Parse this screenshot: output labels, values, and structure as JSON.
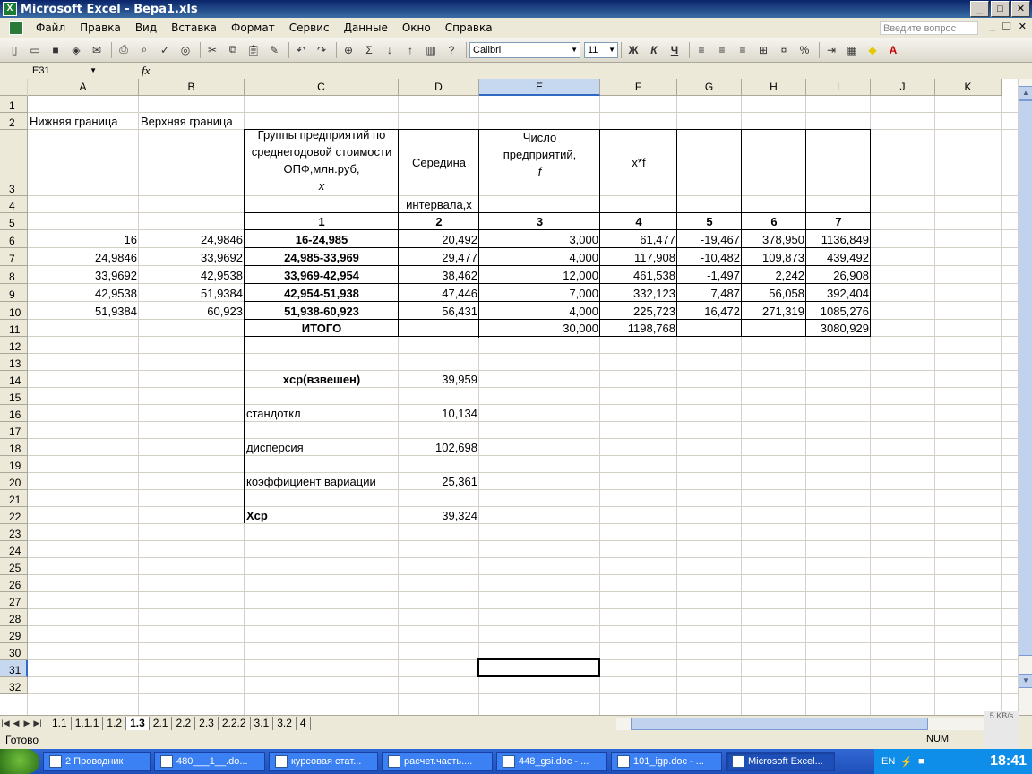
{
  "window": {
    "title": "Microsoft Excel - Вера1.xls",
    "app_icon": "X"
  },
  "menu": {
    "items": [
      "Файл",
      "Правка",
      "Вид",
      "Вставка",
      "Формат",
      "Сервис",
      "Данные",
      "Окно",
      "Справка"
    ],
    "help_placeholder": "Введите вопрос"
  },
  "toolbar": {
    "font_name": "Calibri",
    "font_size": "11",
    "bold": "Ж",
    "italic": "К",
    "underline": "Ч",
    "percent": "%"
  },
  "formula": {
    "cell_ref": "E31",
    "fx": "fx",
    "value": ""
  },
  "columns": [
    "A",
    "B",
    "C",
    "D",
    "E",
    "F",
    "G",
    "H",
    "I",
    "J",
    "K"
  ],
  "rows": [
    "1",
    "2",
    "3",
    "4",
    "5",
    "6",
    "7",
    "8",
    "9",
    "10",
    "11",
    "12",
    "13",
    "14",
    "15",
    "16",
    "17",
    "18",
    "19",
    "20",
    "21",
    "22",
    "23",
    "24",
    "25",
    "26",
    "27",
    "28",
    "29",
    "30",
    "31",
    "32"
  ],
  "sheet": {
    "a2": "Нижняя граница",
    "b2": "Верхняя граница",
    "c2": "Группы предприятий по среднегодовой стоимости ОПФ,млн.руб,",
    "c2x": "x",
    "d2": "Середина",
    "d3": "интервала,x",
    "e2": "Число предприятий,",
    "e2f": "f",
    "f2": "x*f",
    "hdr_nums": [
      "1",
      "2",
      "3",
      "4",
      "5",
      "6",
      "7"
    ],
    "table": [
      [
        "16",
        "24,9846",
        "16-24,985",
        "20,492",
        "3,000",
        "61,477",
        "-19,467",
        "378,950",
        "1136,849"
      ],
      [
        "24,9846",
        "33,9692",
        "24,985-33,969",
        "29,477",
        "4,000",
        "117,908",
        "-10,482",
        "109,873",
        "439,492"
      ],
      [
        "33,9692",
        "42,9538",
        "33,969-42,954",
        "38,462",
        "12,000",
        "461,538",
        "-1,497",
        "2,242",
        "26,908"
      ],
      [
        "42,9538",
        "51,9384",
        "42,954-51,938",
        "47,446",
        "7,000",
        "332,123",
        "7,487",
        "56,058",
        "392,404"
      ],
      [
        "51,9384",
        "60,923",
        "51,938-60,923",
        "56,431",
        "4,000",
        "225,723",
        "16,472",
        "271,319",
        "1085,276"
      ]
    ],
    "total": {
      "label": "ИТОГО",
      "e": "30,000",
      "f": "1198,768",
      "i": "3080,929"
    },
    "stats": [
      {
        "label": "xcp(взвешен)",
        "value": "39,959",
        "bold": true
      },
      {
        "label": "стандоткл",
        "value": "10,134",
        "bold": false
      },
      {
        "label": "дисперсия",
        "value": "102,698",
        "bold": false
      },
      {
        "label": "коэффициент вариации",
        "value": "25,361",
        "bold": false
      },
      {
        "label": "Xcp",
        "value": "39,324",
        "bold": true
      }
    ]
  },
  "tabs": [
    "1.1",
    "1.1.1",
    "1.2",
    "1.3",
    "2.1",
    "2.2",
    "2.3",
    "2.2.2",
    "3.1",
    "3.2",
    "4"
  ],
  "active_tab": "1.3",
  "status": {
    "ready": "Готово",
    "num": "NUM",
    "speed": "5 KB/s"
  },
  "taskbar": {
    "items": [
      "2 Проводник",
      "480___1__.do...",
      "курсовая стат...",
      "расчет.часть....",
      "448_gsi.doc - ...",
      "101_igp.doc - ...",
      "Microsoft Excel..."
    ],
    "lang": "EN",
    "clock": "18:41"
  }
}
